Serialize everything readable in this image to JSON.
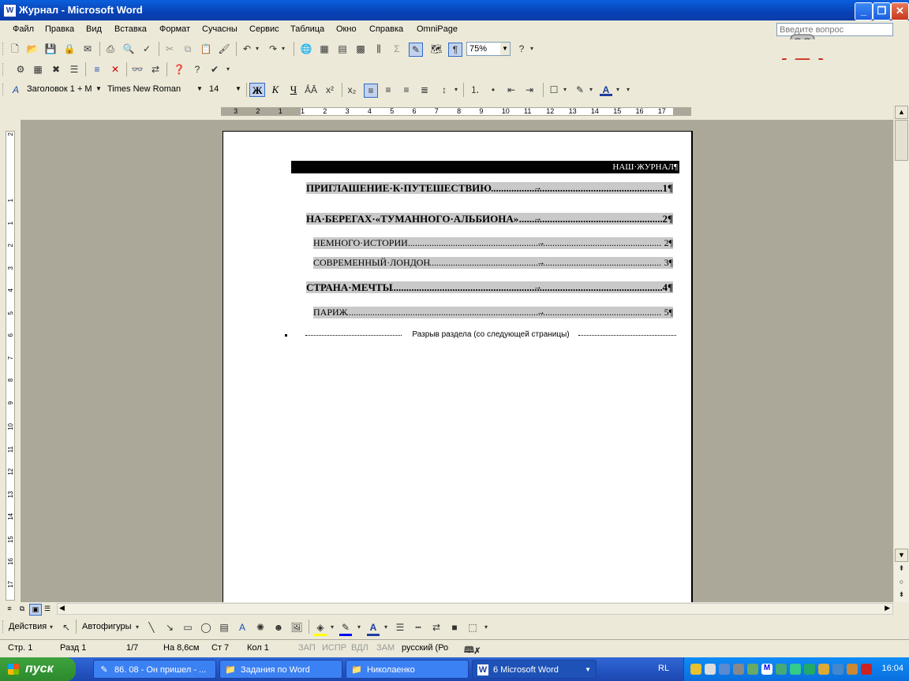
{
  "window": {
    "title": "Журнал - Microsoft Word",
    "app_icon_letter": "W",
    "minimize": "_",
    "maximize": "❐",
    "close": "✕"
  },
  "menu": {
    "items": [
      "Файл",
      "Правка",
      "Вид",
      "Вставка",
      "Формат",
      "Сучасны",
      "Сервис",
      "Таблица",
      "Окно",
      "Справка",
      "OmniPage"
    ],
    "help_placeholder": "Введите вопрос"
  },
  "standard_toolbar": {
    "zoom": "75%"
  },
  "formatting_toolbar": {
    "style": "Заголовок 1 + М",
    "font": "Times New Roman",
    "size": "14",
    "bold": "Ж",
    "italic": "К",
    "underline": "Ч"
  },
  "ruler": {
    "labels": [
      "3",
      "2",
      "1",
      "1",
      "2",
      "3",
      "4",
      "5",
      "6",
      "7",
      "8",
      "9",
      "10",
      "11",
      "12",
      "13",
      "14",
      "15",
      "16",
      "17"
    ],
    "vertical_labels": [
      "2",
      "1",
      "1",
      "2",
      "3",
      "4",
      "5",
      "6",
      "7",
      "8",
      "9",
      "10",
      "11",
      "12",
      "13",
      "14",
      "15",
      "16",
      "17",
      "18",
      "19"
    ]
  },
  "document": {
    "header_text": "НАШ·ЖУРНАЛ¶",
    "toc": [
      {
        "level": 1,
        "label": "ПРИГЛАШЕНИЕ·К·ПУТЕШЕСТВИЮ",
        "page": "1¶"
      },
      {
        "level": 1,
        "label": "НА·БЕРЕГАХ·«ТУМАННОГО·АЛЬБИОНА»",
        "page": "2¶"
      },
      {
        "level": 2,
        "label": "НЕМНОГО·ИСТОРИИ",
        "page": "2¶"
      },
      {
        "level": 2,
        "label": "СОВРЕМЕННЫЙ·ЛОНДОН",
        "page": "3¶"
      },
      {
        "level": 1,
        "label": "СТРАНА·МЕЧТЫ",
        "page": "4¶"
      },
      {
        "level": 2,
        "label": "ПАРИЖ",
        "page": "5¶"
      }
    ],
    "section_break": "Разрыв раздела (со следующей страницы)"
  },
  "drawing_toolbar": {
    "actions": "Действия",
    "autoshapes": "Автофигуры"
  },
  "status": {
    "page": "Стр. 1",
    "section": "Разд 1",
    "pages": "1/7",
    "at": "На 8,6см",
    "line": "Ст 7",
    "col": "Кол 1",
    "rec": "ЗАП",
    "trk": "ИСПР",
    "ext": "ВДЛ",
    "ovr": "ЗАМ",
    "lang": "русский (Ро"
  },
  "taskbar": {
    "start": "пуск",
    "tasks": [
      "86. 08 - Он пришел - ...",
      "Задания по Word",
      "Николаенко",
      "6 Microsoft Word"
    ],
    "lang": "RL",
    "clock": "16:04"
  }
}
